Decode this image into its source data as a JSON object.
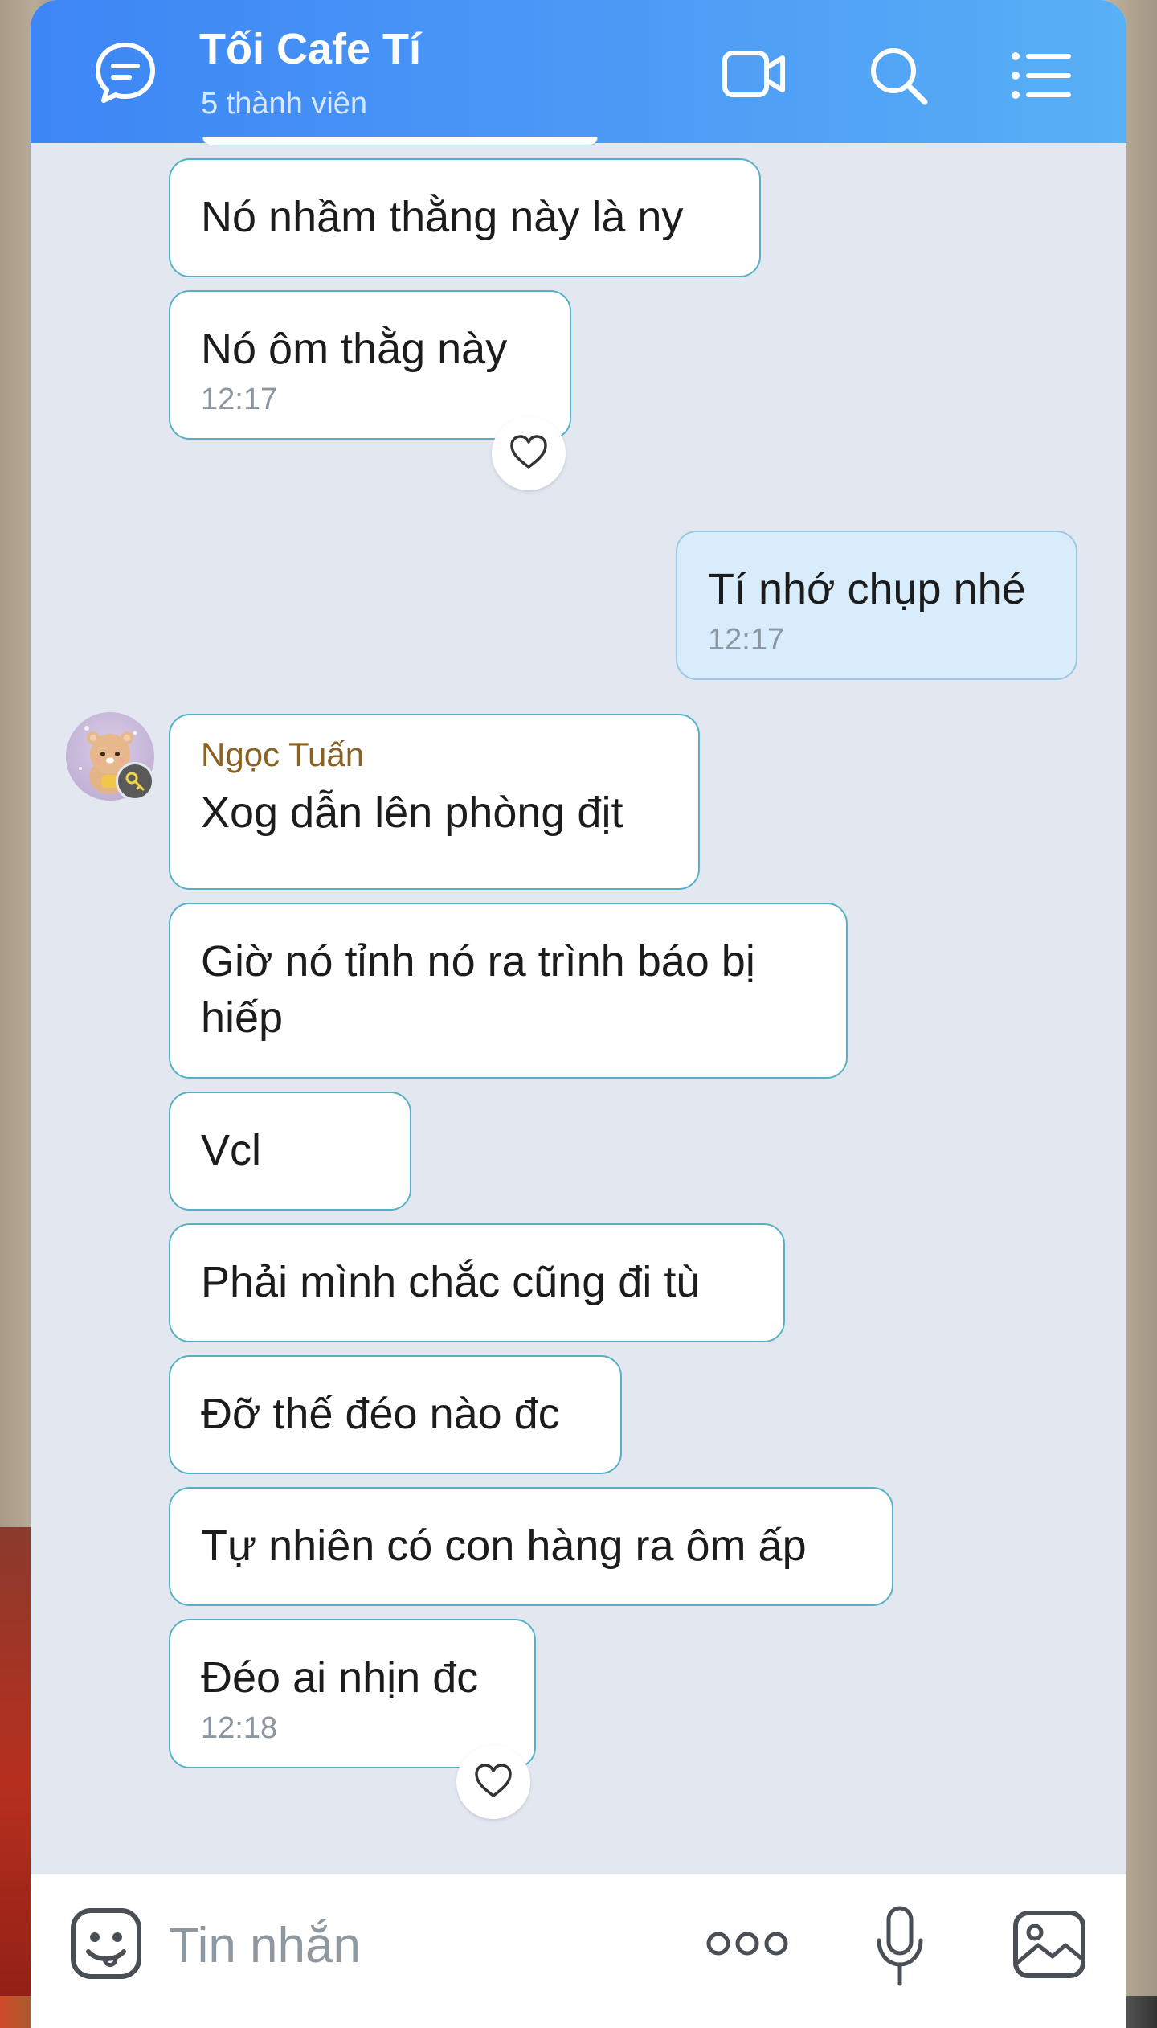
{
  "header": {
    "title": "Tối Cafe Tí",
    "subtitle": "5 thành viên"
  },
  "messages": [
    {
      "text": "Nó nhầm thằng này là ny"
    },
    {
      "text": "Nó ôm thằg này",
      "time": "12:17"
    },
    {
      "text": "Tí nhớ chụp nhé",
      "time": "12:17"
    },
    {
      "sender": "Ngọc Tuấn",
      "text": "Xog dẫn lên phòng địt"
    },
    {
      "text": "Giờ nó tỉnh nó ra trình báo bị\nhiếp"
    },
    {
      "text": "Vcl"
    },
    {
      "text": "Phải mình chắc cũng đi tù"
    },
    {
      "text": "Đỡ thế đéo nào đc"
    },
    {
      "text": "Tự nhiên có con hàng ra ôm ấp"
    },
    {
      "text": "Đéo ai nhịn đc",
      "time": "12:18"
    }
  ],
  "composer": {
    "placeholder": "Tin nhắn"
  },
  "colors": {
    "header_start": "#3d86f5",
    "header_end": "#58b0f5",
    "chat_bg": "#e3e7f0",
    "bubble_border": "#56b1c6",
    "my_bubble": "#d9ecfc",
    "sender_name": "#8a6223"
  },
  "icons": {
    "header": [
      "chat-bubble-icon",
      "video-call-icon",
      "search-icon",
      "menu-list-icon"
    ],
    "composer": [
      "emoji-sticker-icon",
      "more-dots-icon",
      "microphone-icon",
      "image-gallery-icon"
    ],
    "reaction": "heart-icon"
  }
}
